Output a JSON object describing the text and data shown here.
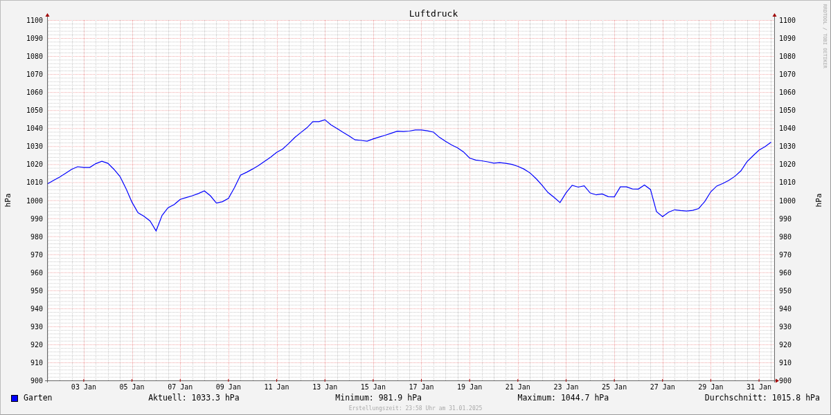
{
  "graph": {
    "title": "Luftdruck",
    "credit": "RRDTOOL / TOBI OETIKER",
    "chart_data": {
      "type": "line",
      "grid": true,
      "ylabel": "hPa",
      "ylim": [
        900,
        1100
      ],
      "yticks": [
        900,
        910,
        920,
        930,
        940,
        950,
        960,
        970,
        980,
        990,
        1000,
        1010,
        1020,
        1030,
        1040,
        1050,
        1060,
        1070,
        1080,
        1090,
        1100
      ],
      "categories": [
        null,
        null,
        null,
        null,
        null,
        null,
        "03 Jan",
        null,
        null,
        null,
        null,
        null,
        null,
        null,
        "05 Jan",
        null,
        null,
        null,
        null,
        null,
        null,
        null,
        "07 Jan",
        null,
        null,
        null,
        null,
        null,
        null,
        null,
        "09 Jan",
        null,
        null,
        null,
        null,
        null,
        null,
        null,
        "11 Jan",
        null,
        null,
        null,
        null,
        null,
        null,
        null,
        "13 Jan",
        null,
        null,
        null,
        null,
        null,
        null,
        null,
        "15 Jan",
        null,
        null,
        null,
        null,
        null,
        null,
        null,
        "17 Jan",
        null,
        null,
        null,
        null,
        null,
        null,
        null,
        "19 Jan",
        null,
        null,
        null,
        null,
        null,
        null,
        null,
        "21 Jan",
        null,
        null,
        null,
        null,
        null,
        null,
        null,
        "23 Jan",
        null,
        null,
        null,
        null,
        null,
        null,
        null,
        "25 Jan",
        null,
        null,
        null,
        null,
        null,
        null,
        null,
        "27 Jan",
        null,
        null,
        null,
        null,
        null,
        null,
        null,
        "29 Jan",
        null,
        null,
        null,
        null,
        null,
        null,
        null,
        "31 Jan",
        null,
        null
      ],
      "series": [
        {
          "name": "Garten",
          "color": "#0000ff",
          "values": [
            1009.1,
            1011,
            1012.9,
            1015,
            1017.2,
            1018.6,
            1018.2,
            1018.2,
            1020.3,
            1021.6,
            1020.5,
            1017.2,
            1013.2,
            1006.5,
            998.9,
            993.1,
            991.1,
            988.5,
            983,
            991.6,
            995.9,
            997.6,
            1000.5,
            1001.5,
            1002.5,
            1003.7,
            1005.2,
            1002.5,
            998.4,
            999.2,
            1001,
            1007,
            1013.9,
            1015.5,
            1017.3,
            1019.3,
            1021.6,
            1023.9,
            1026.6,
            1028.4,
            1031.5,
            1034.8,
            1037.6,
            1040.2,
            1043.6,
            1043.6,
            1044.7,
            1041.9,
            1039.8,
            1037.7,
            1035.7,
            1033.5,
            1033.2,
            1032.8,
            1034,
            1035.1,
            1036.1,
            1037.2,
            1038.3,
            1038.1,
            1038.4,
            1039,
            1039,
            1038.5,
            1037.8,
            1034.9,
            1032.7,
            1030.7,
            1029.1,
            1026.8,
            1023.4,
            1022.3,
            1021.9,
            1021.3,
            1020.6,
            1020.9,
            1020.5,
            1019.9,
            1018.8,
            1017.3,
            1015.2,
            1012.1,
            1008.4,
            1004.3,
            1001.6,
            998.7,
            1004.2,
            1008.3,
            1007.3,
            1008,
            1004,
            1003,
            1003.5,
            1002,
            1001.9,
            1007.4,
            1007.4,
            1006.3,
            1006.2,
            1008.5,
            1006,
            993.7,
            990.9,
            993.4,
            994.7,
            994.3,
            994,
            994.4,
            995.4,
            999.3,
            1004.7,
            1007.9,
            1009.3,
            1011,
            1013.3,
            1016.3,
            1021.4,
            1024.7,
            1027.8,
            1029.8,
            1032.2
          ]
        }
      ]
    },
    "right_axis": {
      "label": "hPa",
      "yticks": [
        "1100",
        "1090",
        "1080",
        "1070",
        "1060",
        "1050",
        "1040",
        "1030",
        "1020",
        "1010",
        "1000",
        "990",
        "980",
        "970",
        "960",
        "950",
        "940",
        "930",
        "920",
        "910",
        "900"
      ]
    }
  },
  "legend": {
    "stats": [
      "Aktuell: 1033.3 hPa",
      "Minimum: 981.9 hPa",
      "Maximum: 1044.7 hPa",
      "Durchschnitt: 1015.8 hPa"
    ]
  },
  "footer": "Erstellungszeit: 23:58 Uhr am 31.01.2025"
}
